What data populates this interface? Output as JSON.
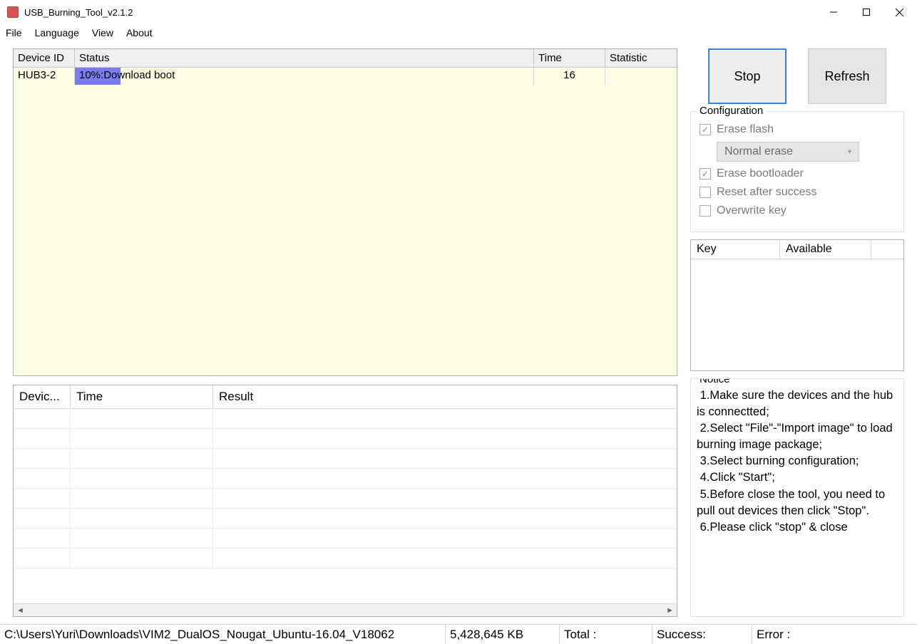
{
  "window": {
    "title": "USB_Burning_Tool_v2.1.2"
  },
  "menu": {
    "file": "File",
    "language": "Language",
    "view": "View",
    "about": "About"
  },
  "devices_table": {
    "headers": {
      "id": "Device ID",
      "status": "Status",
      "time": "Time",
      "statistic": "Statistic"
    },
    "rows": [
      {
        "id": "HUB3-2",
        "status": "10%:Download boot",
        "progress_pct": 10,
        "time": "16",
        "statistic": ""
      }
    ]
  },
  "results_table": {
    "headers": {
      "device": "Devic...",
      "time": "Time",
      "result": "Result"
    }
  },
  "buttons": {
    "stop": "Stop",
    "refresh": "Refresh"
  },
  "config": {
    "title": "Configuration",
    "erase_flash": {
      "label": "Erase flash",
      "checked": true
    },
    "erase_mode": "Normal erase",
    "erase_bootloader": {
      "label": "Erase bootloader",
      "checked": true
    },
    "reset_after_success": {
      "label": "Reset after success",
      "checked": false
    },
    "overwrite_key": {
      "label": "Overwrite key",
      "checked": false
    }
  },
  "key_table": {
    "headers": {
      "key": "Key",
      "available": "Available"
    }
  },
  "notice": {
    "title": "Notice",
    "text": " 1.Make sure the devices and the hub is connectted;\n 2.Select \"File\"-\"Import image\" to load burning image package;\n 3.Select burning configuration;\n 4.Click \"Start\";\n 5.Before close the tool, you need to pull out devices then click \"Stop\".\n 6.Please click \"stop\" & close"
  },
  "statusbar": {
    "path": "C:\\Users\\Yuri\\Downloads\\VIM2_DualOS_Nougat_Ubuntu-16.04_V18062",
    "size": "5,428,645 KB",
    "total": "Total :",
    "success": "Success:",
    "error": "Error :"
  }
}
